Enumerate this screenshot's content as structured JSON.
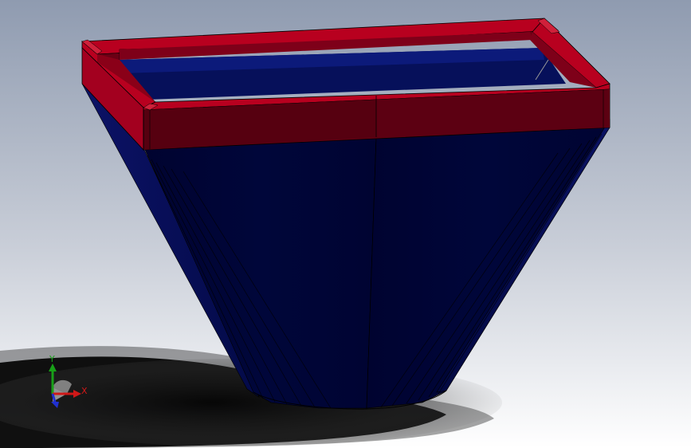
{
  "viewport": {
    "background_top": "#8e9bb0",
    "background_bottom": "#ffffff",
    "shadow_color": "#000000"
  },
  "model": {
    "frame_color": "#a3001f",
    "frame_dark": "#5a0010",
    "hopper_color": "#0b1060",
    "hopper_dark": "#000428",
    "edge_color": "#000000"
  },
  "triad": {
    "x_label": "X",
    "y_label": "Y",
    "x_color": "#d01818",
    "y_color": "#18a018",
    "z_color": "#2030d0"
  }
}
